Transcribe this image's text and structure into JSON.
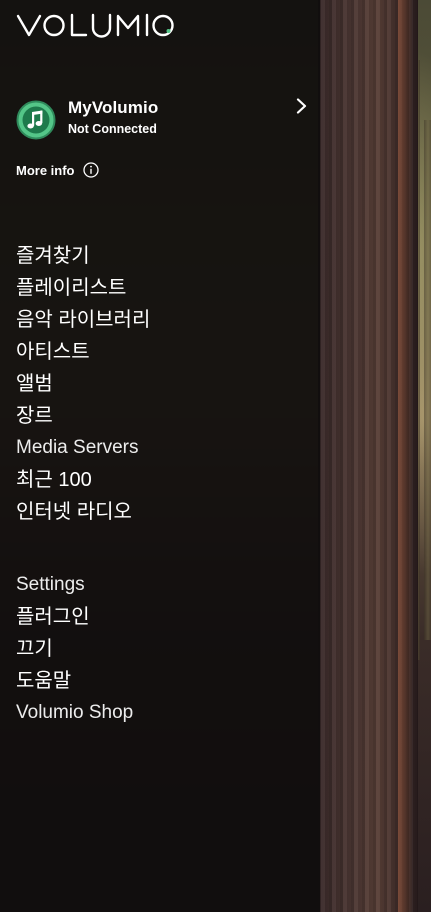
{
  "brand": {
    "logo_text": "VOLUMIO",
    "accent_color": "#54c688"
  },
  "account": {
    "name": "MyVolumio",
    "status": "Not Connected",
    "avatar_icon": "music-note-icon",
    "open_icon": "chevron-right-icon"
  },
  "more_info": {
    "label": "More info",
    "icon": "info-icon"
  },
  "menu": {
    "main": [
      {
        "label": "즐겨찾기"
      },
      {
        "label": "플레이리스트"
      },
      {
        "label": "음악 라이브러리"
      },
      {
        "label": "아티스트"
      },
      {
        "label": "앨범"
      },
      {
        "label": "장르"
      },
      {
        "label": "Media Servers"
      },
      {
        "label": "최근 100"
      },
      {
        "label": "인터넷 라디오"
      }
    ],
    "secondary": [
      {
        "label": "Settings"
      },
      {
        "label": "플러그인"
      },
      {
        "label": "끄기"
      },
      {
        "label": "도움말"
      },
      {
        "label": "Volumio Shop"
      }
    ]
  }
}
